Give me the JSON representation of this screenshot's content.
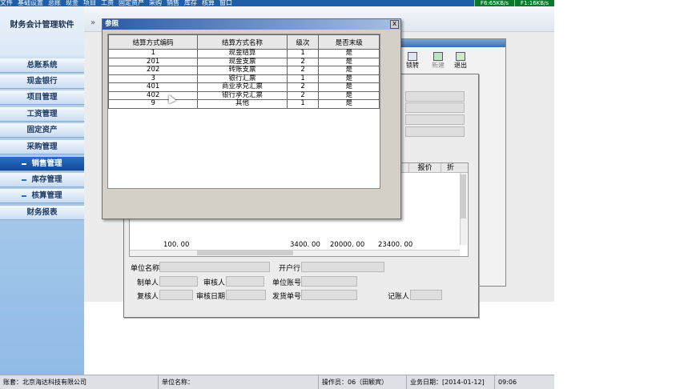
{
  "menu": [
    "文件",
    "基础设置",
    "总账",
    "现金",
    "项目",
    "工资",
    "固定资产",
    "采购",
    "销售",
    "库存",
    "核算",
    "窗口"
  ],
  "indicators": [
    "F6:65KB/s",
    "F1:16KB/s"
  ],
  "brand": "财务会计管理软件",
  "nav": [
    {
      "label": "总账系统",
      "active": false,
      "dash": false
    },
    {
      "label": "现金银行",
      "active": false,
      "dash": false
    },
    {
      "label": "项目管理",
      "active": false,
      "dash": false
    },
    {
      "label": "工资管理",
      "active": false,
      "dash": false
    },
    {
      "label": "固定资产",
      "active": false,
      "dash": false
    },
    {
      "label": "采购管理",
      "active": false,
      "dash": false
    },
    {
      "label": "销售管理",
      "active": true,
      "dash": true
    },
    {
      "label": "库存管理",
      "active": false,
      "dash": true
    },
    {
      "label": "核算管理",
      "active": false,
      "dash": true
    },
    {
      "label": "财务报表",
      "active": false,
      "dash": false
    }
  ],
  "chevron": "»",
  "toolbar": {
    "lock": "锁转",
    "new": "新建",
    "exit": "退出"
  },
  "form": {
    "grid_quote": "报价",
    "grid_fold": "折",
    "totals": [
      "100. 00",
      "3400. 00",
      "20000. 00",
      "23400. 00"
    ],
    "unit_name": "单位名称",
    "bank": "开户行",
    "maker": "制单人",
    "auditor": "审核人",
    "unit_account": "单位账号",
    "rechecker": "复核人",
    "audit_date": "审核日期",
    "invoice_no": "发货单号",
    "bookkeeper": "记账人"
  },
  "dialog": {
    "title": "参照",
    "close": "x",
    "headers": [
      "结算方式编码",
      "结算方式名称",
      "级次",
      "是否末级"
    ],
    "rows": [
      [
        "1",
        "现金结算",
        "1",
        "是"
      ],
      [
        "201",
        "现金支票",
        "2",
        "是"
      ],
      [
        "202",
        "转账支票",
        "2",
        "是"
      ],
      [
        "3",
        "银行汇票",
        "1",
        "是"
      ],
      [
        "401",
        "商业承兑汇票",
        "2",
        "是"
      ],
      [
        "402",
        "银行承兑汇票",
        "2",
        "是"
      ],
      [
        "9",
        "其他",
        "1",
        "是"
      ]
    ]
  },
  "status": {
    "account": "账套：北京海达科技有限公司",
    "unit": "单位名称：",
    "operator": "操作员：06（田颖宾）",
    "bizdate": "业务日期：[2014-01-12]",
    "time": "09:06"
  }
}
